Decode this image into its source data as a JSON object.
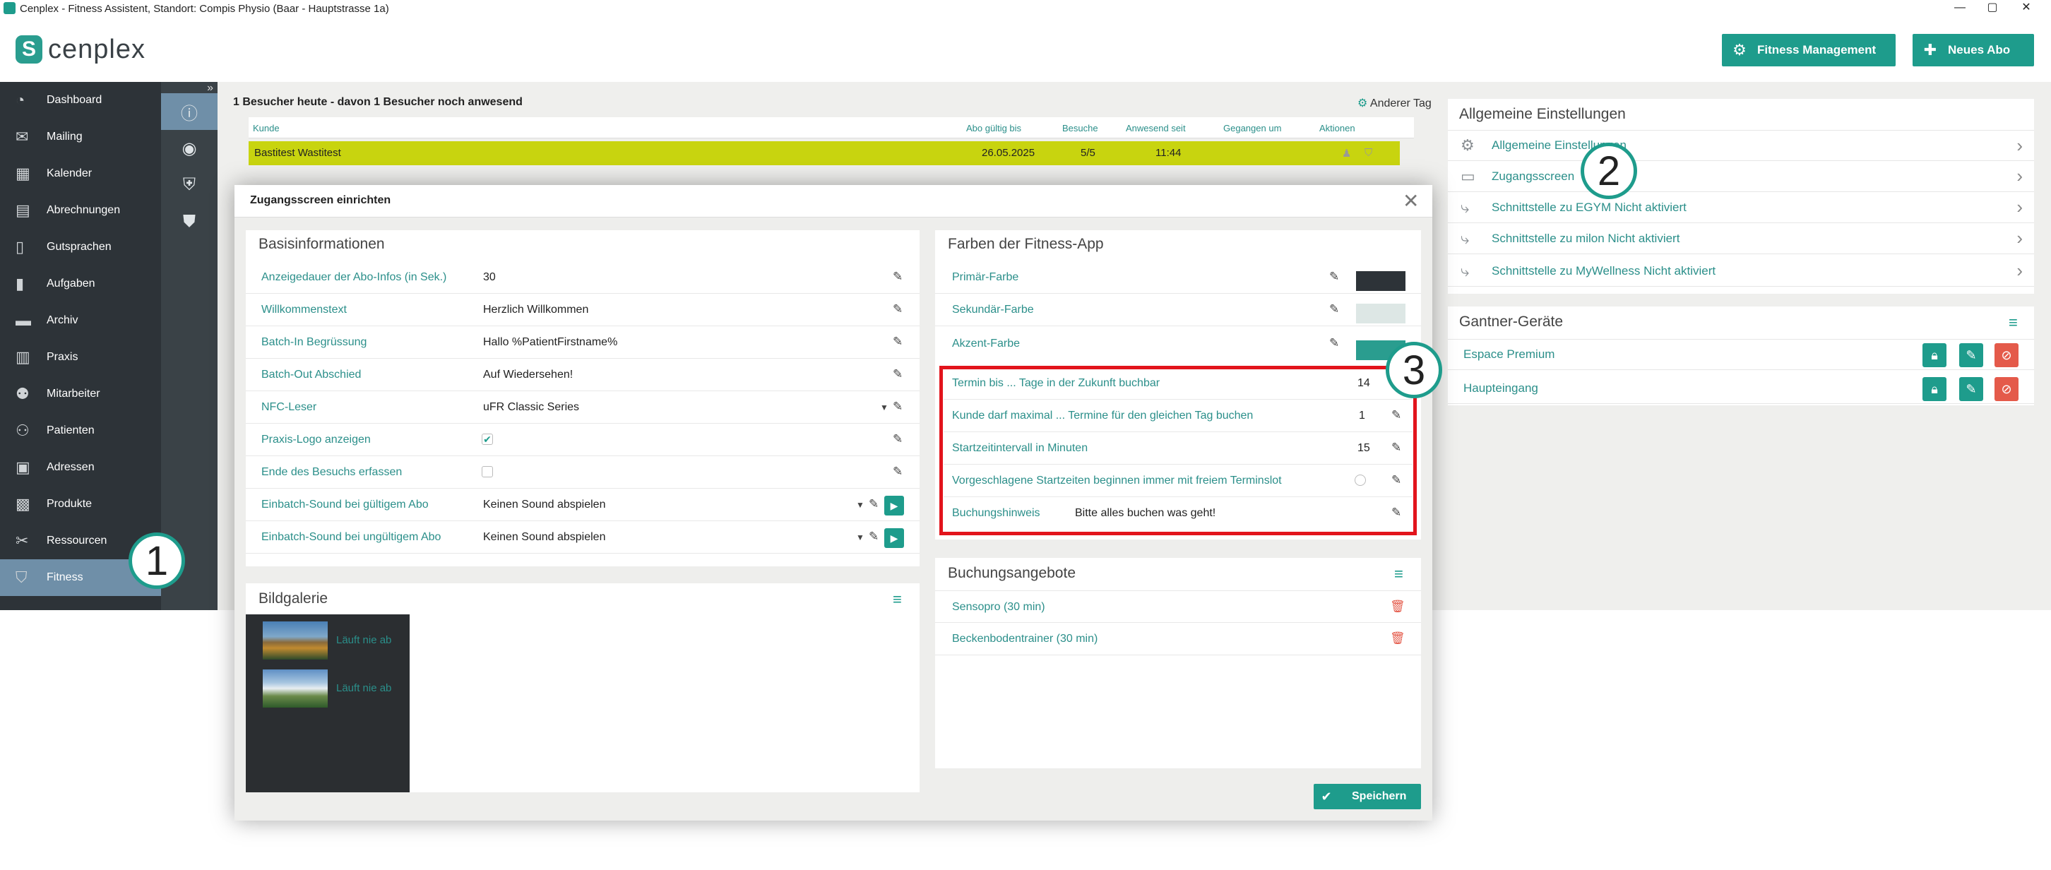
{
  "window": {
    "title": "Cenplex - Fitness Assistent, Standort: Compis Physio (Baar - Hauptstrasse 1a)",
    "controls": [
      "—",
      "▢",
      "✕"
    ]
  },
  "header": {
    "logo_text": "cenplex",
    "buttons": [
      {
        "label": "Fitness Management",
        "icon": "gear-icon"
      },
      {
        "label": "Neues Abo",
        "icon": "plus-icon"
      }
    ]
  },
  "sidebar": {
    "items": [
      {
        "label": "Dashboard",
        "icon": "gauge-icon"
      },
      {
        "label": "Mailing",
        "icon": "mail-icon"
      },
      {
        "label": "Kalender",
        "icon": "calendar-icon"
      },
      {
        "label": "Abrechnungen",
        "icon": "calculator-icon"
      },
      {
        "label": "Gutsprachen",
        "icon": "document-icon"
      },
      {
        "label": "Aufgaben",
        "icon": "clipboard-icon"
      },
      {
        "label": "Archiv",
        "icon": "archive-icon"
      },
      {
        "label": "Praxis",
        "icon": "building-icon"
      },
      {
        "label": "Mitarbeiter",
        "icon": "users-icon"
      },
      {
        "label": "Patienten",
        "icon": "patients-icon"
      },
      {
        "label": "Adressen",
        "icon": "address-book-icon"
      },
      {
        "label": "Produkte",
        "icon": "shop-icon"
      },
      {
        "label": "Ressourcen",
        "icon": "tools-icon"
      },
      {
        "label": "Fitness",
        "icon": "shield-icon",
        "active": true
      }
    ]
  },
  "subbar": {
    "expand_icon": "»",
    "items": [
      "info-icon",
      "eye-icon",
      "shield-check-icon",
      "shield-list-icon"
    ]
  },
  "visitors": {
    "summary": "1 Besucher heute - davon 1 Besucher noch anwesend",
    "other_day": "Anderer Tag",
    "columns": [
      "Kunde",
      "Abo gültig bis",
      "Besuche",
      "Anwesend seit",
      "Gegangen um",
      "Aktionen"
    ],
    "rows": [
      {
        "kunde": "Bastitest Wastitest",
        "abo": "26.05.2025",
        "besuche": "5/5",
        "anwesend": "11:44",
        "gegangen": ""
      }
    ]
  },
  "right": {
    "general_title": "Allgemeine Einstellungen",
    "general_items": [
      {
        "label": "Allgemeine Einstellungen",
        "icon": "gear-icon"
      },
      {
        "label": "Zugangsscreen",
        "icon": "screen-icon"
      },
      {
        "label": "Schnittstelle zu EGYM Nicht aktiviert",
        "icon": "interface-icon"
      },
      {
        "label": "Schnittstelle zu milon Nicht aktiviert",
        "icon": "interface-icon"
      },
      {
        "label": "Schnittstelle zu MyWellness Nicht aktiviert",
        "icon": "interface-icon"
      }
    ],
    "gantner_title": "Gantner-Geräte",
    "gantner_items": [
      {
        "label": "Espace Premium"
      },
      {
        "label": "Haupteingang"
      }
    ]
  },
  "annotations": [
    "1",
    "2",
    "3"
  ],
  "dialog": {
    "title": "Zugangsscreen einrichten",
    "close": "✕",
    "basis": {
      "title": "Basisinformationen",
      "rows": [
        {
          "label": "Anzeigedauer der Abo-Infos (in Sek.)",
          "value": "30"
        },
        {
          "label": "Willkommenstext",
          "value": "Herzlich Willkommen"
        },
        {
          "label": "Batch-In Begrüssung",
          "value": "Hallo %PatientFirstname%"
        },
        {
          "label": "Batch-Out Abschied",
          "value": "Auf Wiedersehen!"
        },
        {
          "label": "NFC-Leser",
          "value": "uFR Classic Series"
        },
        {
          "label": "Praxis-Logo anzeigen",
          "value": ""
        },
        {
          "label": "Ende des Besuchs erfassen",
          "value": ""
        },
        {
          "label": "Einbatch-Sound bei gültigem Abo",
          "value": "Keinen Sound abspielen"
        },
        {
          "label": "Einbatch-Sound bei ungültigem Abo",
          "value": "Keinen Sound abspielen"
        }
      ]
    },
    "gallery": {
      "title": "Bildgalerie",
      "items": [
        {
          "label": "Läuft nie ab"
        },
        {
          "label": "Läuft nie ab"
        }
      ]
    },
    "farben": {
      "title": "Farben der Fitness-App",
      "rows": [
        {
          "label": "Primär-Farbe",
          "color": "#2d3338"
        },
        {
          "label": "Sekundär-Farbe",
          "color": "#dde7e5"
        },
        {
          "label": "Akzent-Farbe",
          "color": "#2a9d8f"
        }
      ],
      "booking_rows": [
        {
          "label": "Termin bis ... Tage in der Zukunft buchbar",
          "value": "14"
        },
        {
          "label": "Kunde darf maximal ... Termine für den gleichen Tag buchen",
          "value": "1"
        },
        {
          "label": "Startzeitintervall in Minuten",
          "value": "15"
        },
        {
          "label": "Vorgeschlagene Startzeiten beginnen immer mit freiem Terminslot",
          "value": ""
        },
        {
          "label": "Buchungshinweis",
          "value": "Bitte alles buchen was geht!"
        }
      ]
    },
    "angebote": {
      "title": "Buchungsangebote",
      "items": [
        {
          "label": "Sensopro (30 min)"
        },
        {
          "label": "Beckenbodentrainer (30 min)"
        }
      ]
    },
    "save_label": "Speichern"
  }
}
